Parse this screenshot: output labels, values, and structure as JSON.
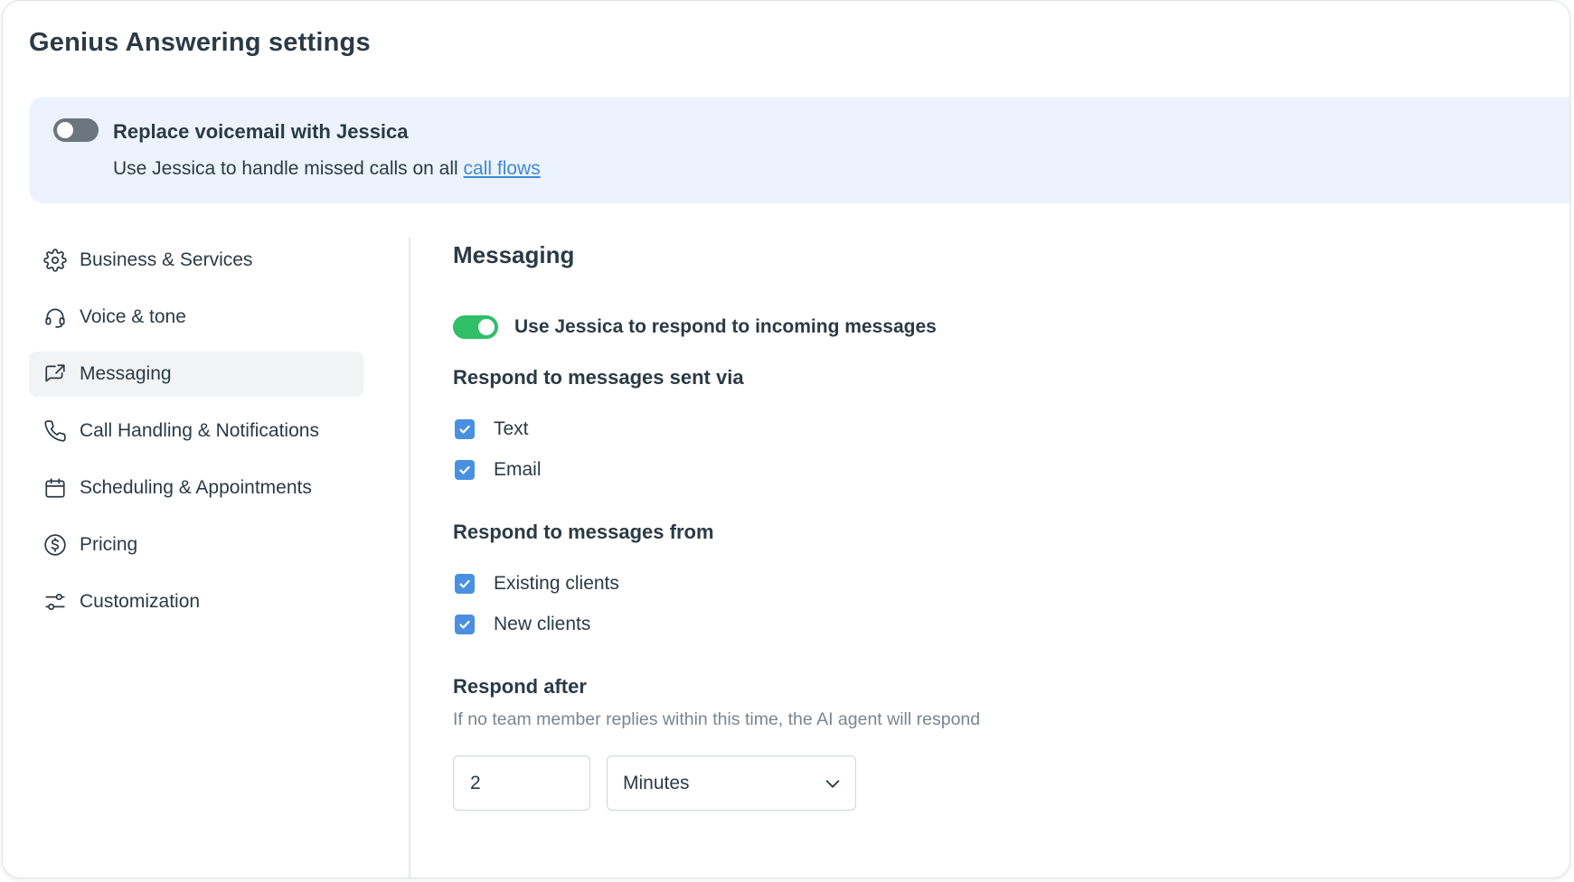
{
  "page": {
    "title": "Genius Answering settings"
  },
  "banner": {
    "toggle_on": false,
    "title": "Replace voicemail with Jessica",
    "description": "Use Jessica to handle missed calls on all",
    "link_text": "call flows"
  },
  "sidebar": {
    "items": [
      {
        "label": "Business & Services",
        "icon": "gear-icon",
        "active": false
      },
      {
        "label": "Voice & tone",
        "icon": "headset-icon",
        "active": false
      },
      {
        "label": "Messaging",
        "icon": "message-share-icon",
        "active": true
      },
      {
        "label": "Call Handling & Notifications",
        "icon": "phone-icon",
        "active": false
      },
      {
        "label": "Scheduling & Appointments",
        "icon": "calendar-icon",
        "active": false
      },
      {
        "label": "Pricing",
        "icon": "dollar-circle-icon",
        "active": false
      },
      {
        "label": "Customization",
        "icon": "sliders-icon",
        "active": false
      }
    ]
  },
  "messaging": {
    "title": "Messaging",
    "toggle_on": true,
    "toggle_label": "Use Jessica to respond to incoming messages",
    "sent_via": {
      "heading": "Respond to messages sent via",
      "options": [
        {
          "label": "Text",
          "checked": true
        },
        {
          "label": "Email",
          "checked": true
        }
      ]
    },
    "from": {
      "heading": "Respond to messages from",
      "options": [
        {
          "label": "Existing clients",
          "checked": true
        },
        {
          "label": "New clients",
          "checked": true
        }
      ]
    },
    "respond_after": {
      "heading": "Respond after",
      "hint": "If no team member replies within this time, the AI agent will respond",
      "value": "2",
      "unit": "Minutes"
    }
  },
  "colors": {
    "accent": "#4a90e2",
    "toggle_on": "#2fbf67",
    "toggle_off": "#6b767f",
    "banner_bg": "#ecf3fd",
    "link": "#3f89d8"
  }
}
